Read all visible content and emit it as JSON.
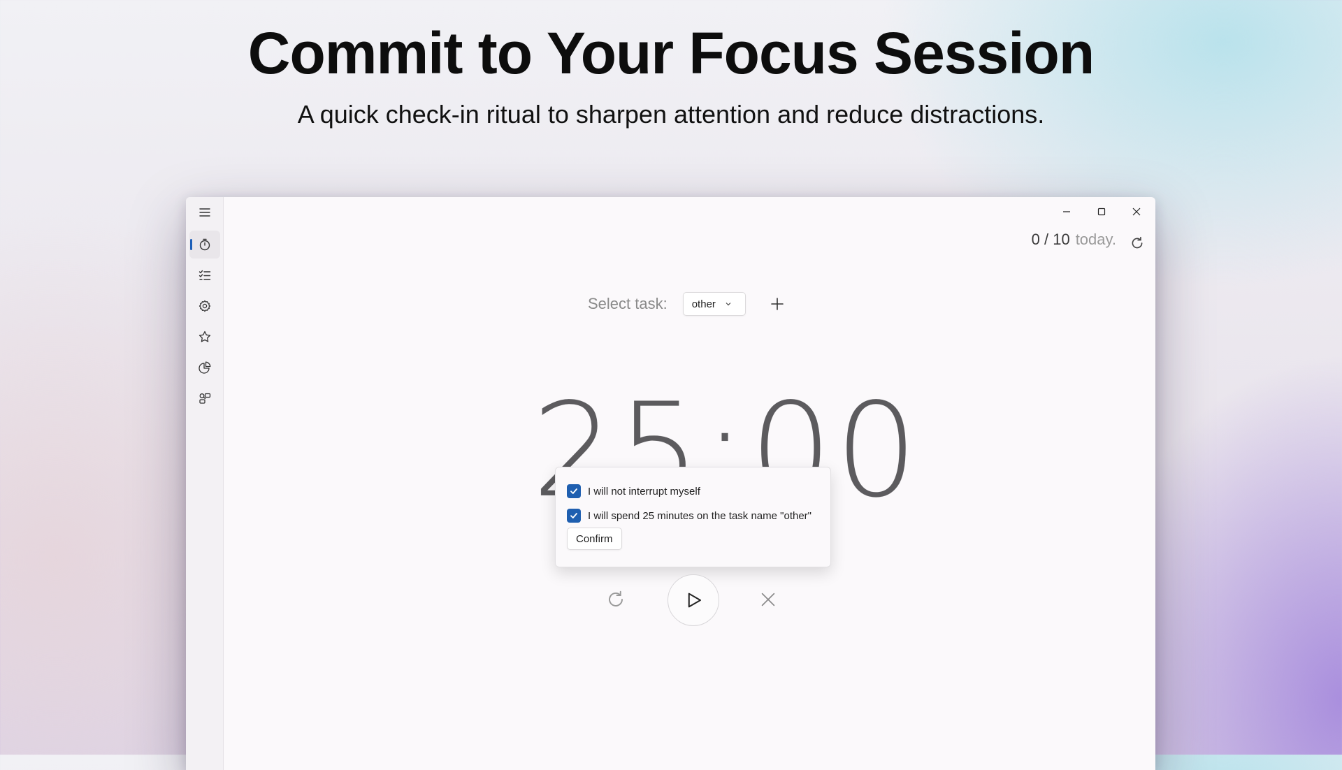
{
  "hero": {
    "title": "Commit to Your Focus Session",
    "subtitle": "A quick check-in ritual to sharpen attention and reduce distractions."
  },
  "sidebar": {
    "items": [
      {
        "icon": "hamburger-menu-icon"
      },
      {
        "icon": "timer-icon",
        "active": true
      },
      {
        "icon": "task-list-icon"
      },
      {
        "icon": "settings-gear-icon"
      },
      {
        "icon": "star-icon"
      },
      {
        "icon": "statistics-pie-icon"
      },
      {
        "icon": "integrations-icon"
      }
    ]
  },
  "window_controls": {
    "icons": [
      "minimize-icon",
      "maximize-icon",
      "close-icon"
    ]
  },
  "stats": {
    "count": "0 / 10",
    "suffix": "today."
  },
  "task": {
    "label": "Select task:",
    "selected": "other"
  },
  "timer": {
    "display": "25:00"
  },
  "commitment": {
    "items": [
      {
        "label": "I will not interrupt myself",
        "checked": true
      },
      {
        "label": "I will spend 25 minutes on the task name \"other\"",
        "checked": true
      }
    ],
    "confirm_label": "Confirm"
  },
  "colors": {
    "accent": "#1f5fb0",
    "window_bg": "#fbf9fb",
    "sidebar_bg": "#f3f1f4"
  }
}
